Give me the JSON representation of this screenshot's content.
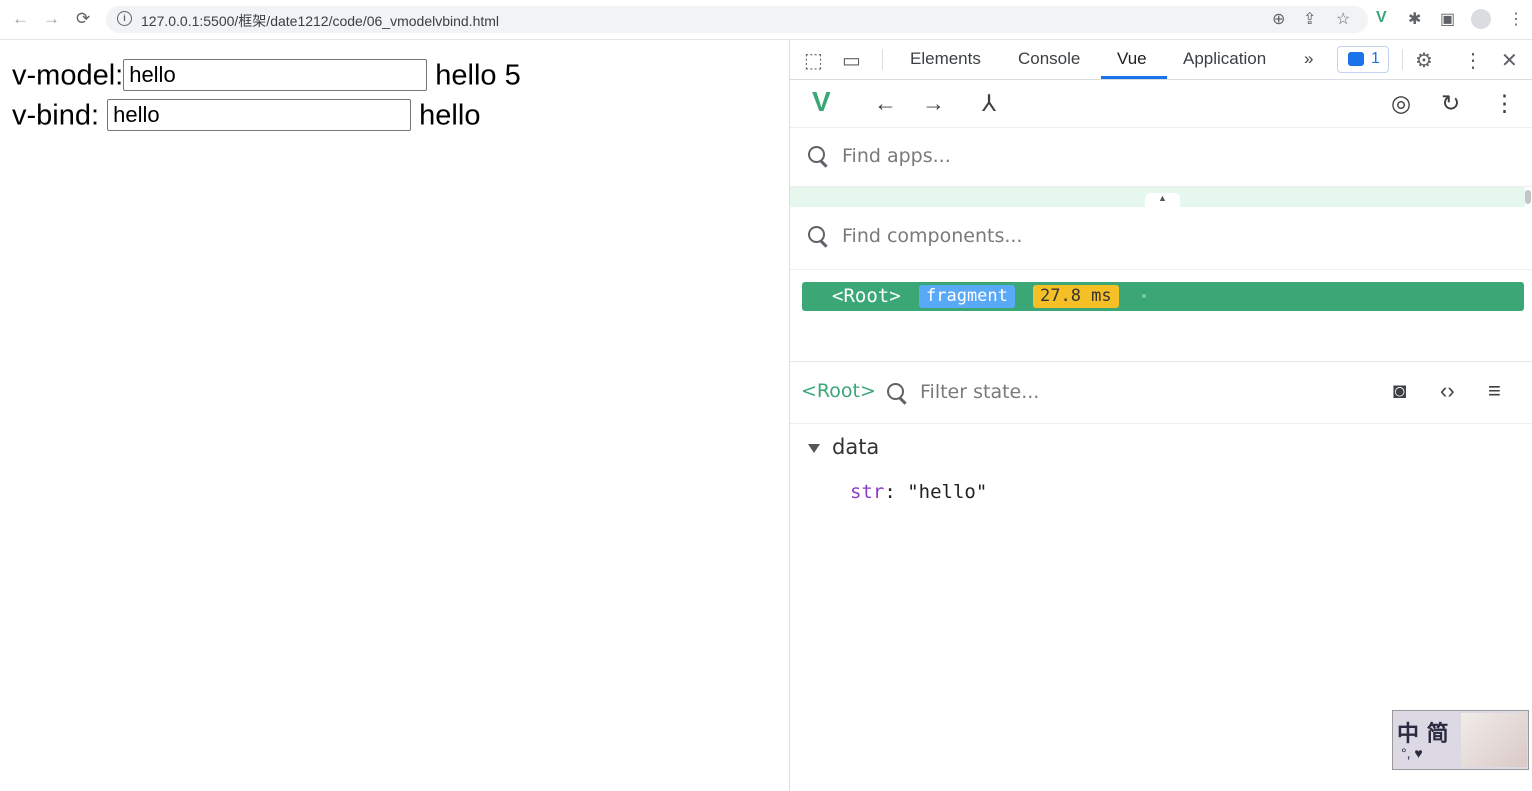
{
  "browser": {
    "url": "127.0.0.1:5500/框架/date1212/code/06_vmodelvbind.html",
    "nav": {
      "back": "←",
      "forward": "→",
      "reload": "⟳"
    }
  },
  "page": {
    "vmodel_label": "v-model:",
    "vmodel_value": "hello",
    "vmodel_output": "hello 5",
    "vbind_label": "v-bind:",
    "vbind_value": "hello",
    "vbind_output": "hello"
  },
  "devtools": {
    "tabs": [
      "Elements",
      "Console",
      "Vue",
      "Application"
    ],
    "active_tab": "Vue",
    "more_tabs": "»",
    "message_count": "1",
    "find_apps_placeholder": "Find apps...",
    "find_components_placeholder": "Find components...",
    "tree": {
      "root": "<Root>",
      "badge": "fragment",
      "time": "27.8 ms"
    },
    "inspector": {
      "selected": "<Root>",
      "filter_placeholder": "Filter state...",
      "section": "data",
      "props": [
        {
          "key": "str",
          "value": "\"hello\""
        }
      ]
    }
  },
  "floating_widget": {
    "text": "中 简",
    "subtext": "°, ♥"
  },
  "colors": {
    "vue_green": "#3ba776",
    "fragment_blue": "#5aa9f7",
    "time_yellow": "#f4c026",
    "active_tab": "#1a73e8"
  }
}
